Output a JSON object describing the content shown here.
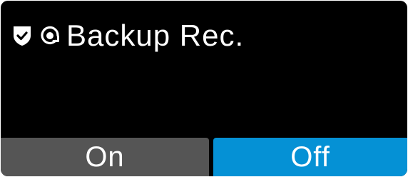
{
  "header": {
    "title": "Backup Rec.",
    "icons": [
      "shield-check-icon",
      "backup-record-icon"
    ]
  },
  "options": {
    "on_label": "On",
    "off_label": "Off",
    "selected": "Off"
  },
  "colors": {
    "background": "#000000",
    "text": "#ffffff",
    "unselected_button": "#555555",
    "selected_button": "#0591d5"
  }
}
